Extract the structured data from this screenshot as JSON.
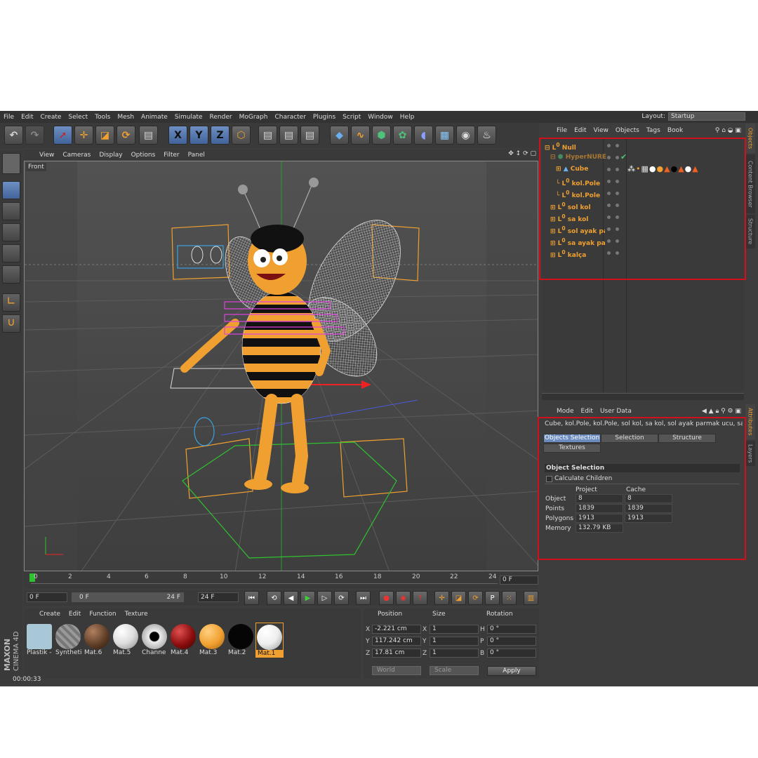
{
  "menu": [
    "File",
    "Edit",
    "Create",
    "Select",
    "Tools",
    "Mesh",
    "Animate",
    "Simulate",
    "Render",
    "MoGraph",
    "Character",
    "Plugins",
    "Script",
    "Window",
    "Help"
  ],
  "layout": {
    "label": "Layout:",
    "value": "Startup"
  },
  "viewport": {
    "menu": [
      "View",
      "Cameras",
      "Display",
      "Options",
      "Filter",
      "Panel"
    ],
    "label": "Front"
  },
  "toolbar_icons": [
    "undo-icon",
    "redo-icon",
    "select-arrow-icon",
    "move-icon",
    "scale-icon",
    "rotate-icon",
    "render-clip-icon",
    "x-axis-icon",
    "y-axis-icon",
    "z-axis-icon",
    "world-coord-icon",
    "render-view-icon",
    "render-picture-icon",
    "render-settings-icon",
    "cube-primitive-icon",
    "spline-icon",
    "nurbs-icon",
    "mograph-cloner-icon",
    "deformer-icon",
    "environment-floor-icon",
    "camera-icon",
    "light-icon"
  ],
  "axis_labels": {
    "x": "X",
    "y": "Y",
    "z": "Z"
  },
  "timeline": {
    "ticks": [
      "0",
      "2",
      "4",
      "6",
      "8",
      "10",
      "12",
      "14",
      "16",
      "18",
      "20",
      "22",
      "24"
    ],
    "current_frame": "0 F"
  },
  "playback": {
    "start": "0 F",
    "range_start": "0 F",
    "range_end": "24 F",
    "end": "24 F"
  },
  "materials": {
    "menu": [
      "Create",
      "Edit",
      "Function",
      "Texture"
    ],
    "items": [
      {
        "name": "Plastik -",
        "color": "#a8c8d8"
      },
      {
        "name": "Syntheti",
        "color": "#8a8a8a"
      },
      {
        "name": "Mat.6",
        "color": "#5a3a24"
      },
      {
        "name": "Mat.5",
        "color": "#f0f0f0"
      },
      {
        "name": "Channe",
        "color": "#1a1a1a"
      },
      {
        "name": "Mat.4",
        "color": "#8c0d0d"
      },
      {
        "name": "Mat.3",
        "color": "#f0a030"
      },
      {
        "name": "Mat.2",
        "color": "#050505"
      },
      {
        "name": "Mat.1",
        "color": "#ffffff"
      }
    ]
  },
  "coords": {
    "headers": {
      "position": "Position",
      "size": "Size",
      "rotation": "Rotation"
    },
    "rows": [
      {
        "axis": "X",
        "pos": "-2.221 cm",
        "size_axis": "X",
        "size": "1",
        "rot_axis": "H",
        "rot": "0 °"
      },
      {
        "axis": "Y",
        "pos": "117.242 cm",
        "size_axis": "Y",
        "size": "1",
        "rot_axis": "P",
        "rot": "0 °"
      },
      {
        "axis": "Z",
        "pos": "17.81 cm",
        "size_axis": "Z",
        "size": "1",
        "rot_axis": "B",
        "rot": "0 °"
      }
    ],
    "mode": "World",
    "scale": "Scale",
    "apply": "Apply"
  },
  "status": {
    "time": "00:00:33"
  },
  "brand": {
    "line1": "MAXON",
    "line2": "CINEMA 4D"
  },
  "objects": {
    "menu": [
      "File",
      "Edit",
      "View",
      "Objects",
      "Tags",
      "Book"
    ],
    "items": [
      {
        "name": "Null"
      },
      {
        "name": "HyperNURE"
      },
      {
        "name": "Cube"
      },
      {
        "name": "kol.Pole"
      },
      {
        "name": "kol.Pole"
      },
      {
        "name": "sol kol"
      },
      {
        "name": "sa kol"
      },
      {
        "name": "sol ayak pa"
      },
      {
        "name": "sa ayak par"
      },
      {
        "name": "kalça"
      }
    ]
  },
  "side_tabs": {
    "top": [
      "Objects",
      "Content Browser",
      "Structure"
    ],
    "bottom": [
      "Attributes",
      "Layers"
    ]
  },
  "attributes": {
    "menu": [
      "Mode",
      "Edit",
      "User Data"
    ],
    "selection": "Cube, kol.Pole, kol.Pole, sol kol, sa kol, sol ayak parmak ucu, sa a",
    "tabs": [
      "Objects Selection",
      "Selection",
      "Structure",
      "Textures"
    ],
    "section": "Object Selection",
    "calc_children": "Calculate Children",
    "col_project": "Project",
    "col_cache": "Cache",
    "rows": [
      {
        "label": "Object",
        "project": "8",
        "cache": "8"
      },
      {
        "label": "Points",
        "project": "1839",
        "cache": "1839"
      },
      {
        "label": "Polygons",
        "project": "1913",
        "cache": "1913"
      },
      {
        "label": "Memory",
        "project": "132.79 KB"
      }
    ]
  },
  "colors": {
    "accent": "#f0a030",
    "selection_blue": "#6c8cc0",
    "highlight_red": "#d0101a"
  }
}
